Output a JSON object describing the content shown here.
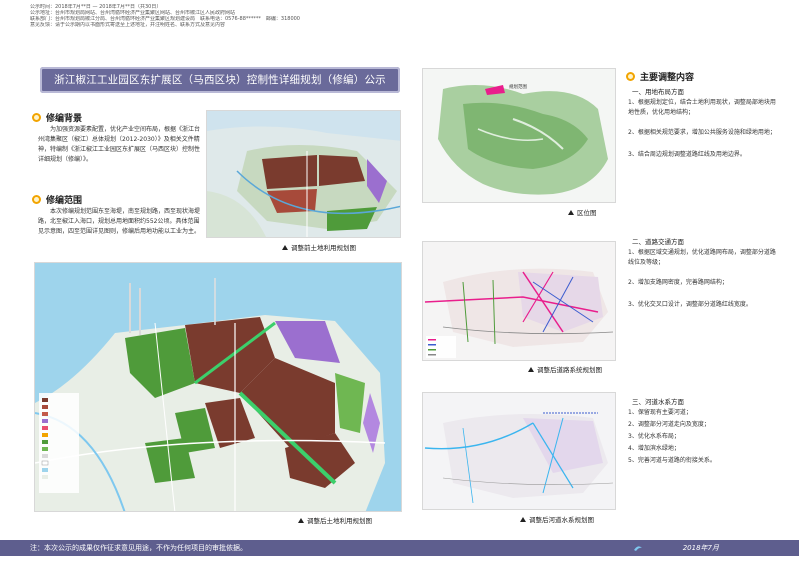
{
  "header_info": [
    "公示时间：2018年7月**日 — 2018年7月**日（共30日）",
    "公示地址：台州市规划局网站、台州湾循环经济产业集聚区网站、台州市椒江区人民政府网站",
    "联系部门：台州市规划局椒江分局、台州湾循环经济产业集聚区规划建设局　联系电话：0576-88******　邮编：318000",
    "意见反馈：请于公示期内以书面形式寄送至上述地址，并注明姓名、联系方式及意见内容"
  ],
  "title": "浙江椒江工业园区东扩展区（马西区块）控制性详细规划（修编）公示",
  "sections": {
    "background": {
      "heading": "修编背景",
      "text": "为加强资源要素配置，优化产业空间布局，根据《浙江台州湾集聚区（椒江）总体规划（2012-2030）》及相关文件精神，特编制《浙江椒江工业园区东扩展区（马西区块）控制性详细规划（修编）》。"
    },
    "scope": {
      "heading": "修编范围",
      "text": "本次修编规划范围东至海堤，南至规划路，西至现状海堤路，北至椒江入海口，规划总用地面积约552公顷。具体范围见示意图，四至范围详见图则，修编后用地功能以工业为主。"
    }
  },
  "captions": {
    "location": "区位图",
    "before_land": "调整前土地利用规划图",
    "after_land": "调整后土地利用规划图",
    "before_road": "调整后道路系统规划图",
    "after_water": "调整后河道水系规划图"
  },
  "location_label": "规划范围",
  "right": {
    "heading": "主要调整内容",
    "groups": [
      {
        "title": "一、用地布局方面",
        "items": [
          "1、根据规划定位，结合土地利用现状，调整局部地块用地性质，优化用地结构；",
          "2、根据相关规范要求，增加公共服务设施和绿地用地；",
          "3、结合周边规划调整道路红线及用地边界。"
        ]
      },
      {
        "title": "二、道路交通方面",
        "items": [
          "1、根据区域交通规划，优化道路网布局，调整部分道路线位及等级；",
          "2、增加支路网密度，完善路网结构；",
          "3、优化交叉口设计，调整部分道路红线宽度。"
        ]
      },
      {
        "title": "三、河道水系方面",
        "items": [
          "1、保留现有主要河道；",
          "2、调整部分河道走向及宽度；",
          "3、优化水系布局；",
          "4、增加滨水绿地；",
          "5、完善河道与道路的衔接关系。"
        ]
      }
    ]
  },
  "legend_entries": [
    "一类工业用地",
    "二类工业用地",
    "三类工业用地",
    "物流仓储用地",
    "商业服务业设施用地",
    "公共设施用地",
    "公园绿地",
    "防护绿地",
    "广场用地",
    "道路用地",
    "水域",
    "其他"
  ],
  "footer": {
    "note": "注：本次公示的成果仅作征求意见用途，不作为任何项目的审批依据。",
    "date": "2018年7月"
  },
  "colors": {
    "industrial": "#7a3b2e",
    "green": "#4f9b3a",
    "purple": "#9b6fcf",
    "water": "#b9e0f2",
    "accent": "#5e5e8e",
    "bullet": "#f2a400"
  }
}
